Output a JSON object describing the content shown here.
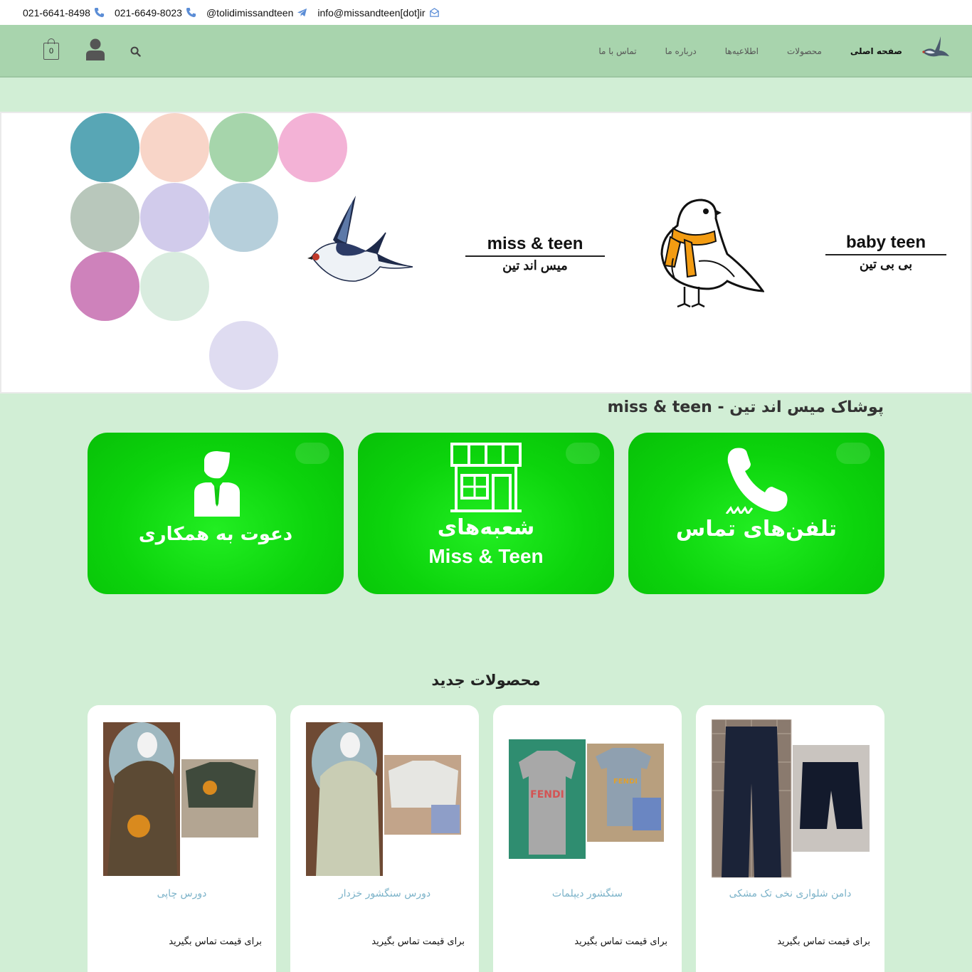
{
  "topbar": {
    "phone1": "021-6641-8498",
    "phone2": "021-6649-8023",
    "telegram": "@tolidimissandteen",
    "email": "info@missandteen[dot]ir"
  },
  "nav": {
    "cart_count": "0",
    "menu": [
      {
        "label": "صفحه اصلی"
      },
      {
        "label": "محصولات"
      },
      {
        "label": "اطلاعیه‌ها"
      },
      {
        "label": "درباره ما"
      },
      {
        "label": "تماس با ما"
      }
    ]
  },
  "hero": {
    "circle_colors": [
      "#58a6b5",
      "#f8d5c8",
      "#a6d5ab",
      "#f3b2d6",
      "#b8c7bb",
      "#d1cbeb",
      "#b6cfdb",
      "#ce82bb",
      "#d9ecdf",
      "#dfdcf1"
    ],
    "brand1_en": "miss & teen",
    "brand1_fa": "میس اند تین",
    "brand2_en": "baby teen",
    "brand2_fa": "بی بی تین"
  },
  "main": {
    "section_title": "پوشاک میس اند تین - miss & teen",
    "cards": [
      {
        "title": "تلفن‌های تماس",
        "subtitle": ""
      },
      {
        "title": "شعبه‌های",
        "subtitle": "Miss & Teen"
      },
      {
        "title": "دعوت به همکاری",
        "subtitle": ""
      }
    ],
    "products_title": "محصولات جدید",
    "products": [
      {
        "name": "دامن شلواری نخی تک مشکی",
        "price": "برای قیمت تماس بگیرید"
      },
      {
        "name": "سنگشور دیپلمات",
        "price": "برای قیمت تماس بگیرید"
      },
      {
        "name": "دورس سنگشور خزدار",
        "price": "برای قیمت تماس بگیرید"
      },
      {
        "name": "دورس چاپی",
        "price": "برای قیمت تماس بگیرید"
      }
    ]
  }
}
